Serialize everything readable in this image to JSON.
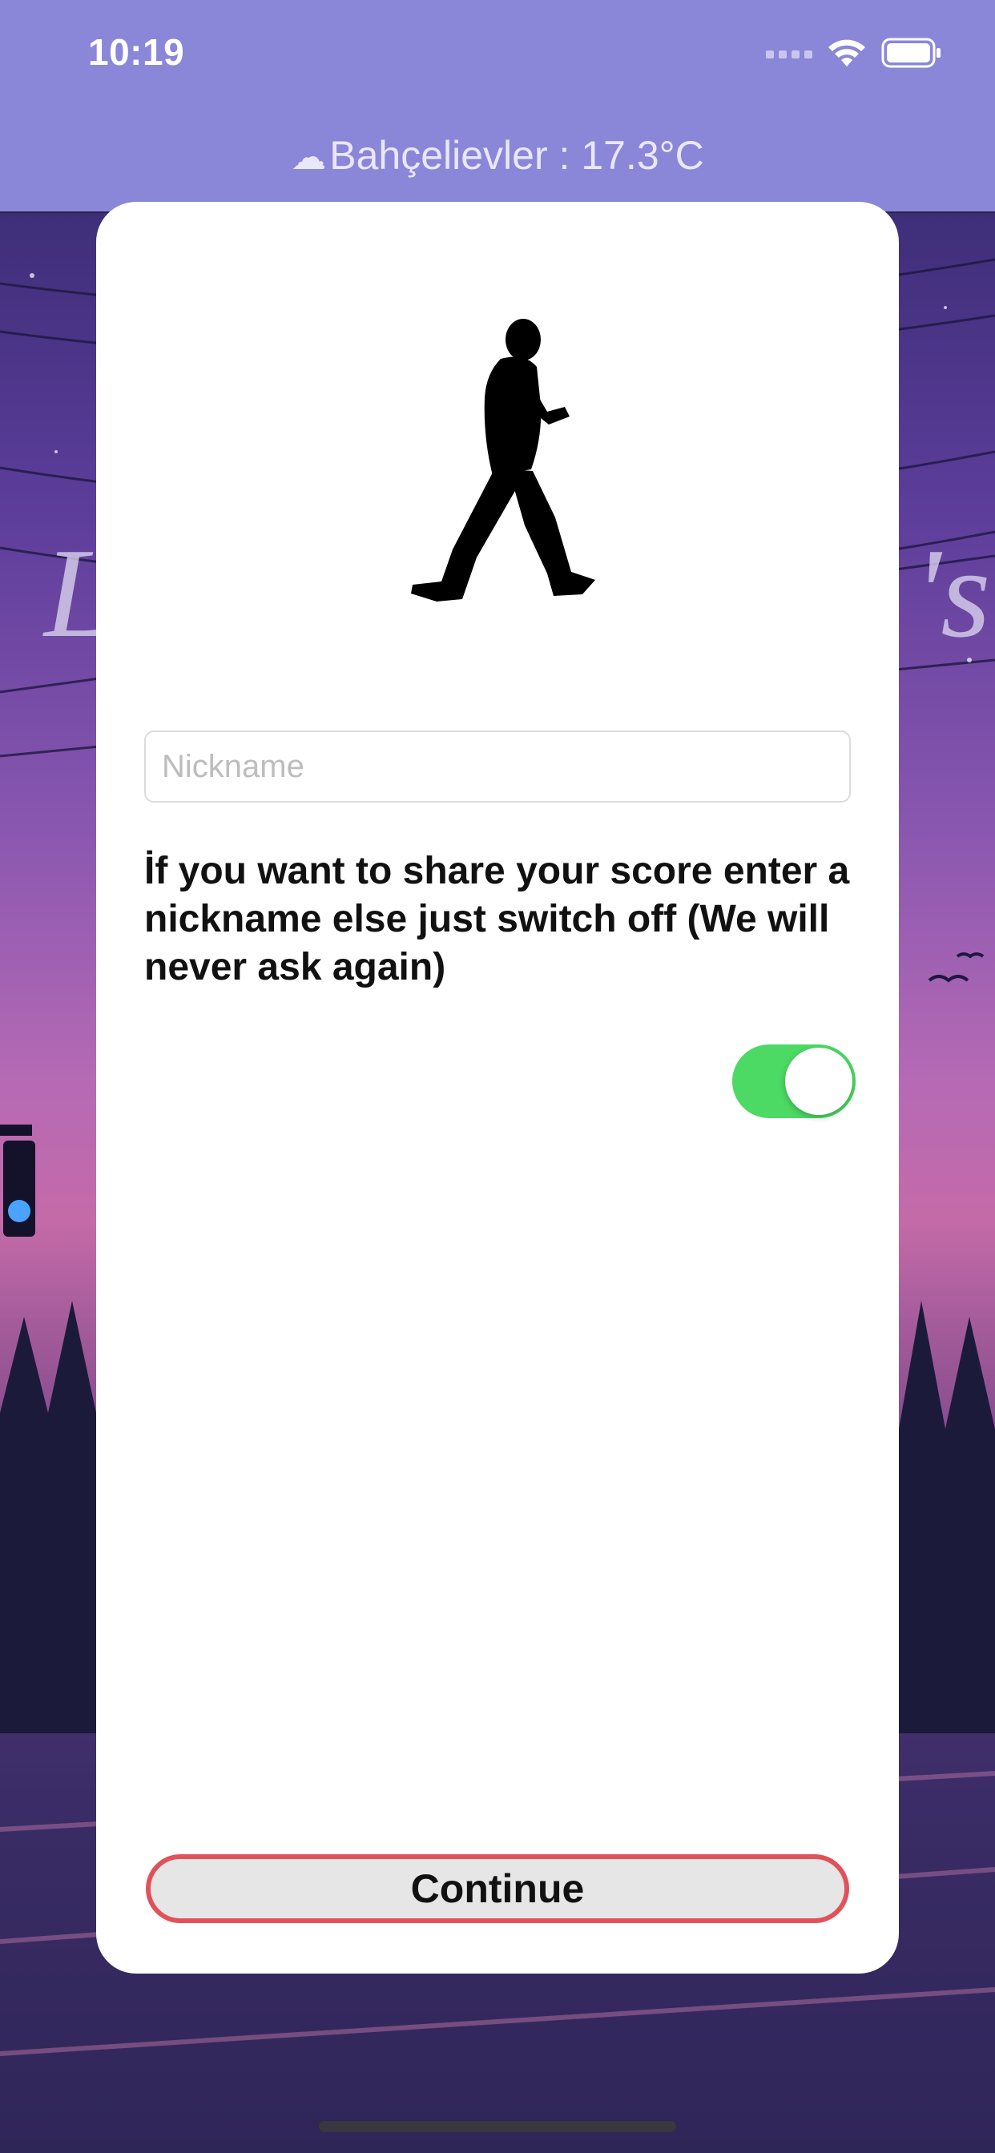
{
  "status_bar": {
    "time": "10:19",
    "icons": [
      "cellular-signal-icon",
      "wifi-icon",
      "battery-icon"
    ]
  },
  "weather": {
    "icon": "cloud-icon",
    "location": "Bahçelievler",
    "separator": " : ",
    "temperature": "17.3°C"
  },
  "card": {
    "illustration": "walking-man-silhouette",
    "nickname_input": {
      "value": "",
      "placeholder": "Nickname"
    },
    "info_text": "İf you want to share your score enter a nickname else just switch off (We will never ask again)",
    "share_toggle": {
      "on": true
    },
    "continue_label": "Continue"
  },
  "colors": {
    "header_bg": "#8a86d8",
    "toggle_on": "#4cd964",
    "continue_border": "#e0525a",
    "continue_bg": "#e6e6e6"
  }
}
